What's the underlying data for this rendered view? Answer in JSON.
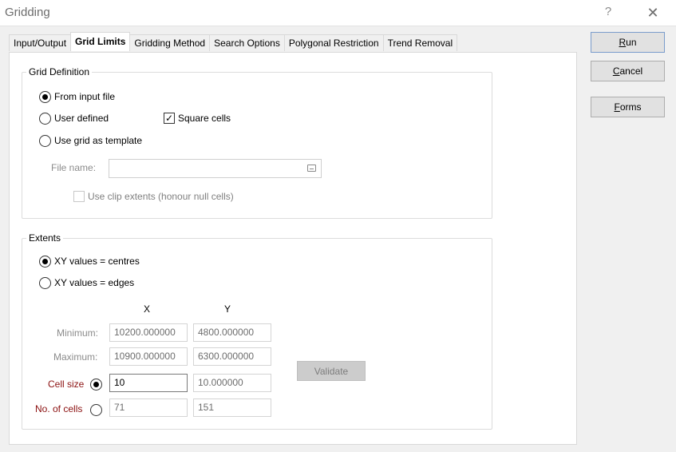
{
  "window": {
    "title": "Gridding",
    "help_glyph": "?",
    "close_glyph": "✕"
  },
  "tabs": [
    {
      "label": "Input/Output",
      "active": false
    },
    {
      "label": "Grid Limits",
      "active": true
    },
    {
      "label": "Gridding Method",
      "active": false
    },
    {
      "label": "Search Options",
      "active": false
    },
    {
      "label": "Polygonal Restriction",
      "active": false
    },
    {
      "label": "Trend Removal",
      "active": false
    }
  ],
  "grid_definition": {
    "legend": "Grid Definition",
    "from_input_file": {
      "label": "From input file",
      "selected": true
    },
    "user_defined": {
      "label": "User defined",
      "selected": false
    },
    "use_grid_as_template": {
      "label": "Use grid as template",
      "selected": false
    },
    "square_cells": {
      "label": "Square cells",
      "checked": true
    },
    "file_name_label": "File name:",
    "file_name_value": "",
    "clip_extents": {
      "label": "Use clip extents (honour null cells)",
      "checked": false
    }
  },
  "extents": {
    "legend": "Extents",
    "xy_centres": {
      "label": "XY values = centres",
      "selected": true
    },
    "xy_edges": {
      "label": "XY values = edges",
      "selected": false
    },
    "col_x": "X",
    "col_y": "Y",
    "minimum_label": "Minimum:",
    "minimum_x": "10200.000000",
    "minimum_y": "4800.000000",
    "maximum_label": "Maximum:",
    "maximum_x": "10900.000000",
    "maximum_y": "6300.000000",
    "cell_size_label": "Cell size",
    "cell_size_selected": true,
    "cell_size_x": "10",
    "cell_size_y": "10.000000",
    "no_cells_label": "No. of cells",
    "no_cells_selected": false,
    "no_cells_x": "71",
    "no_cells_y": "151",
    "validate_label": "Validate"
  },
  "buttons": {
    "run_mnemonic": "R",
    "run_rest": "un",
    "cancel_mnemonic": "C",
    "cancel_rest": "ancel",
    "forms_mnemonic": "F",
    "forms_rest": "orms"
  },
  "colors": {
    "required_label": "#8b1010",
    "disabled_text": "#8c8c8c",
    "dialog_bg": "#f0f0f0"
  }
}
